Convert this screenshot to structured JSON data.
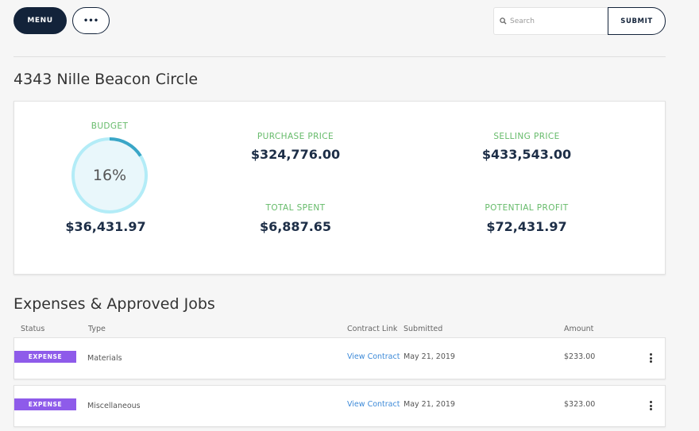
{
  "toolbar": {
    "menu_label": "MENU",
    "more_label": "•••",
    "search_placeholder": "Search",
    "search_icon": "search-icon",
    "submit_label": "SUBMIT"
  },
  "property": {
    "title": "4343 Nille Beacon Circle"
  },
  "summary": {
    "budget": {
      "label": "BUDGET",
      "percent_text": "16%",
      "percent": 0.16,
      "value": "$36,431.97"
    },
    "purchase_price": {
      "label": "PURCHASE PRICE",
      "value": "$324,776.00"
    },
    "selling_price": {
      "label": "SELLING PRICE",
      "value": "$433,543.00"
    },
    "total_spent": {
      "label": "TOTAL SPENT",
      "value": "$6,887.65"
    },
    "potential_profit": {
      "label": "POTENTIAL PROFIT",
      "value": "$72,431.97"
    }
  },
  "expenses": {
    "title": "Expenses & Approved Jobs",
    "columns": {
      "status": "Status",
      "type": "Type",
      "contract_link": "Contract Link",
      "submitted": "Submitted",
      "amount": "Amount"
    },
    "rows": [
      {
        "status": "EXPENSE",
        "type": "Materials",
        "contract": "View Contract",
        "submitted": "May 21, 2019",
        "amount": "$233.00"
      },
      {
        "status": "EXPENSE",
        "type": "Miscellaneous",
        "contract": "View Contract",
        "submitted": "May 21, 2019",
        "amount": "$323.00"
      }
    ]
  },
  "colors": {
    "primary": "#13233a",
    "label_green": "#66bb6a",
    "badge_purple": "#8e5bea",
    "link_blue": "#3d8ad8",
    "ring_light": "#b3ecf7",
    "ring_progress": "#3aa6c7"
  }
}
